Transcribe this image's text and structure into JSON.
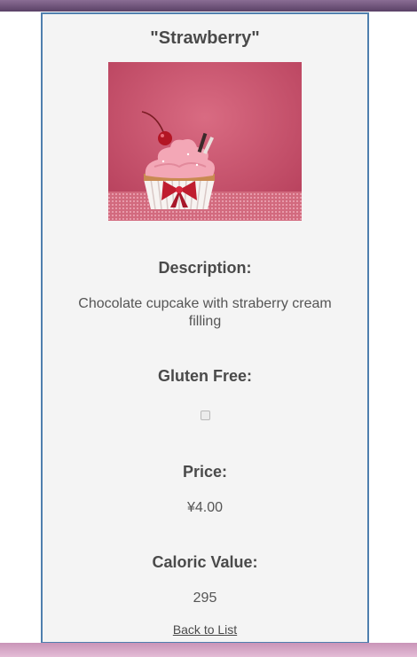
{
  "product": {
    "title": "\"Strawberry\"",
    "image_alt": "strawberry cupcake photo",
    "description_label": "Description:",
    "description": "Chocolate cupcake with straberry cream filling",
    "gluten_free_label": "Gluten Free:",
    "gluten_free": false,
    "price_label": "Price:",
    "price": "¥4.00",
    "caloric_label": "Caloric Value:",
    "caloric_value": "295"
  },
  "nav": {
    "back_label": "Back to List"
  },
  "colors": {
    "card_border": "#4f7fae",
    "card_bg": "#f4f4f4",
    "top_bar": "#5a4166",
    "bottom_bar": "#d8a8c6"
  }
}
